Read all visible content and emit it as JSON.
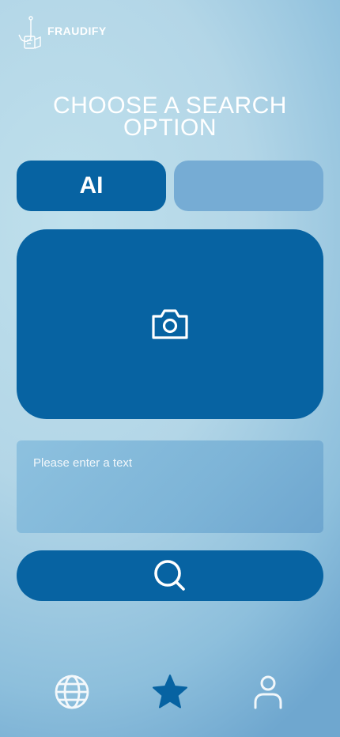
{
  "app": {
    "name": "FRAUDIFY"
  },
  "page": {
    "title_line1": "CHOOSE A SEARCH",
    "title_line2": "OPTION"
  },
  "tabs": [
    {
      "label": "AI",
      "selected": true
    },
    {
      "label": "",
      "selected": false
    }
  ],
  "upload": {
    "icon": "camera-icon"
  },
  "text_input": {
    "placeholder": "Please enter a text",
    "value": ""
  },
  "search_button": {
    "icon": "search-icon"
  },
  "bottom_nav": {
    "items": [
      {
        "icon": "globe-icon",
        "active": false
      },
      {
        "icon": "star-icon",
        "active": true
      },
      {
        "icon": "user-icon",
        "active": false
      }
    ]
  },
  "colors": {
    "primary": "#0763a2",
    "inactive_tab": "#76acd4",
    "nav_inactive": "#ffffff"
  }
}
